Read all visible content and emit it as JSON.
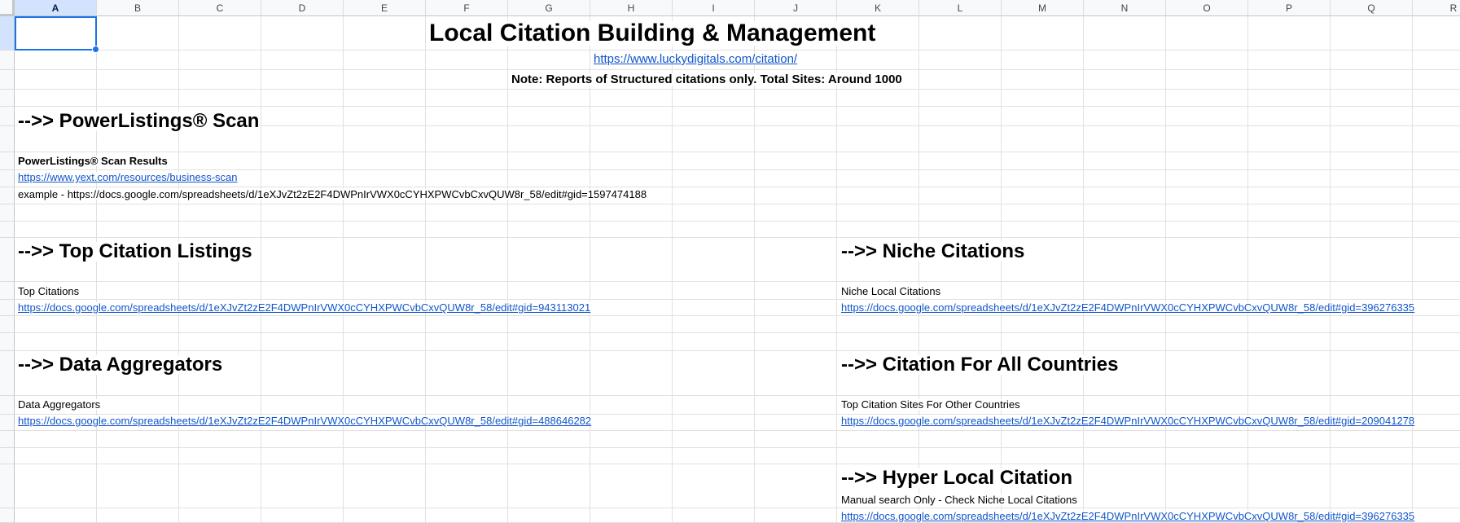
{
  "columns": [
    "A",
    "B",
    "C",
    "D",
    "E",
    "F",
    "G",
    "H",
    "I",
    "J",
    "K",
    "L",
    "M",
    "N",
    "O",
    "P",
    "Q",
    "R"
  ],
  "selected_cell": "A1",
  "header": {
    "title": "Local Citation Building & Management",
    "url": "https://www.luckydigitals.com/citation/",
    "note": "Note: Reports of Structured citations only. Total Sites: Around 1000"
  },
  "powerlistings": {
    "heading": "-->> PowerListings® Scan",
    "label": "PowerListings® Scan Results",
    "link": "https://www.yext.com/resources/business-scan",
    "example": "example - https://docs.google.com/spreadsheets/d/1eXJvZt2zE2F4DWPnIrVWX0cCYHXPWCvbCxvQUW8r_58/edit#gid=1597474188"
  },
  "top_citations": {
    "heading": "-->> Top Citation Listings",
    "label": "Top Citations",
    "link": "https://docs.google.com/spreadsheets/d/1eXJvZt2zE2F4DWPnIrVWX0cCYHXPWCvbCxvQUW8r_58/edit#gid=943113021"
  },
  "niche_citations": {
    "heading": "-->> Niche Citations",
    "label": "Niche Local Citations",
    "link": "https://docs.google.com/spreadsheets/d/1eXJvZt2zE2F4DWPnIrVWX0cCYHXPWCvbCxvQUW8r_58/edit#gid=396276335"
  },
  "data_aggregators": {
    "heading": "-->> Data Aggregators",
    "label": "Data Aggregators",
    "link": "https://docs.google.com/spreadsheets/d/1eXJvZt2zE2F4DWPnIrVWX0cCYHXPWCvbCxvQUW8r_58/edit#gid=488646282"
  },
  "all_countries": {
    "heading": "-->> Citation For All Countries",
    "label": "Top Citation Sites For Other Countries",
    "link": "https://docs.google.com/spreadsheets/d/1eXJvZt2zE2F4DWPnIrVWX0cCYHXPWCvbCxvQUW8r_58/edit#gid=209041278"
  },
  "hyper_local": {
    "heading": "-->> Hyper Local Citation",
    "label": "Manual search Only - Check Niche Local Citations",
    "link": "https://docs.google.com/spreadsheets/d/1eXJvZt2zE2F4DWPnIrVWX0cCYHXPWCvbCxvQUW8r_58/edit#gid=396276335"
  },
  "colors": {
    "link": "#1155cc",
    "selection": "#1a73e8",
    "header_bg": "#f8f9fa",
    "selected_header_bg": "#d3e3fd"
  }
}
